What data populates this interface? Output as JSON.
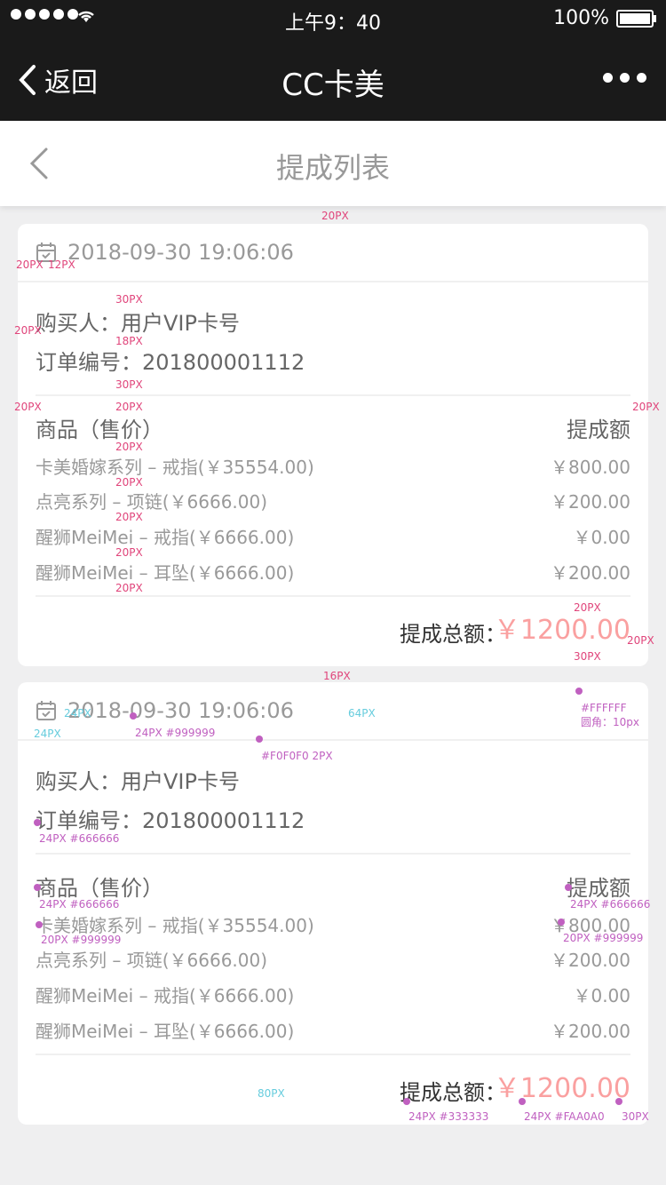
{
  "status_bar": {
    "time": "上午9：40",
    "battery": "100%"
  },
  "navbar": {
    "back_label": "返回",
    "title": "CC卡美"
  },
  "subheader": {
    "title": "提成列表"
  },
  "cards": [
    {
      "date": "2018-09-30 19:06:06",
      "buyer": "购买人：用户VIP卡号",
      "order": "订单编号：201800001112",
      "head_left": "商品（售价）",
      "head_right": "提成额",
      "items": [
        {
          "name": "卡美婚嫁系列 – 戒指(￥35554.00)",
          "amount": "￥800.00"
        },
        {
          "name": "点亮系列 – 项链(￥6666.00)",
          "amount": "￥200.00"
        },
        {
          "name": "醒狮MeiMei – 戒指(￥6666.00)",
          "amount": "￥0.00"
        },
        {
          "name": "醒狮MeiMei – 耳坠(￥6666.00)",
          "amount": "￥200.00"
        }
      ],
      "total_label": "提成总额：",
      "total_value": "￥1200.00"
    },
    {
      "date": "2018-09-30 19:06:06",
      "buyer": "购买人：用户VIP卡号",
      "order": "订单编号：201800001112",
      "head_left": "商品（售价）",
      "head_right": "提成额",
      "items": [
        {
          "name": "卡美婚嫁系列 – 戒指(￥35554.00)",
          "amount": "￥800.00"
        },
        {
          "name": "点亮系列 – 项链(￥6666.00)",
          "amount": "￥200.00"
        },
        {
          "name": "醒狮MeiMei – 戒指(￥6666.00)",
          "amount": "￥0.00"
        },
        {
          "name": "醒狮MeiMei – 耳坠(￥6666.00)",
          "amount": "￥200.00"
        }
      ],
      "total_label": "提成总额：",
      "total_value": "￥1200.00"
    }
  ],
  "annotations": {
    "a20": "20PX",
    "a12": "12PX",
    "a30": "30PX",
    "a18": "18PX",
    "a16": "16PX",
    "a24": "24PX",
    "a64": "64PX",
    "a80": "80PX",
    "date_font": "24PX #999999",
    "divider": "#F0F0F0 2PX",
    "card_bg": "#FFFFFF",
    "card_radius": "圆角：10px",
    "info_font": "24PX #666666",
    "item_font": "20PX #999999",
    "total_label_font": "24PX #333333",
    "total_val_font": "24PX #FAA0A0"
  },
  "colors": {
    "nav_bg": "#1a1a1a",
    "accent": "#FAA0A0",
    "divider": "#F0F0F0"
  }
}
